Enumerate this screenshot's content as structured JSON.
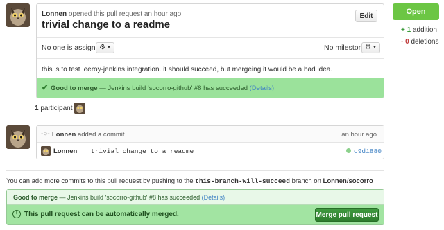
{
  "pr": {
    "author": "Lonnen",
    "opened_text": "opened this pull request an hour ago",
    "title": "trivial change to a readme",
    "edit_label": "Edit",
    "assignee_text": "No one is assigned",
    "milestone_text": "No milestone",
    "body": "this is to test leeroy-jenkins integration. it should succeed, but mergeing it would be a bad idea.",
    "status_strong": "Good to merge",
    "status_text": "— Jenkins build 'socorro-github' #8 has succeeded",
    "status_link": "(Details)"
  },
  "sidebar": {
    "state_label": "Open",
    "additions_count": "+ 1",
    "additions_label": "addition",
    "deletions_count": "- 0",
    "deletions_label": "deletions"
  },
  "participants": {
    "count": "1",
    "label": "participant"
  },
  "commit_event": {
    "author": "Lonnen",
    "action": "added a commit",
    "time": "an hour ago",
    "commit_author": "Lonnen",
    "message": "trivial change to a readme",
    "sha": "c9d1880"
  },
  "merge_info": {
    "prefix": "You can add more commits to this pull request by pushing to the",
    "branch": "this-branch-will-succeed",
    "middle": "branch on",
    "repo": "Lonnen/socorro"
  },
  "merge_box": {
    "status_strong": "Good to merge",
    "status_text": "— Jenkins build 'socorro-github' #8 has succeeded",
    "status_link": "(Details)",
    "mergeable_text": "This pull request can be automatically merged.",
    "merge_button": "Merge pull request"
  },
  "colors": {
    "open_green": "#6cc644",
    "status_green": "#9be29b",
    "dark_green": "#3b8a3b",
    "link_blue": "#4183c4"
  }
}
